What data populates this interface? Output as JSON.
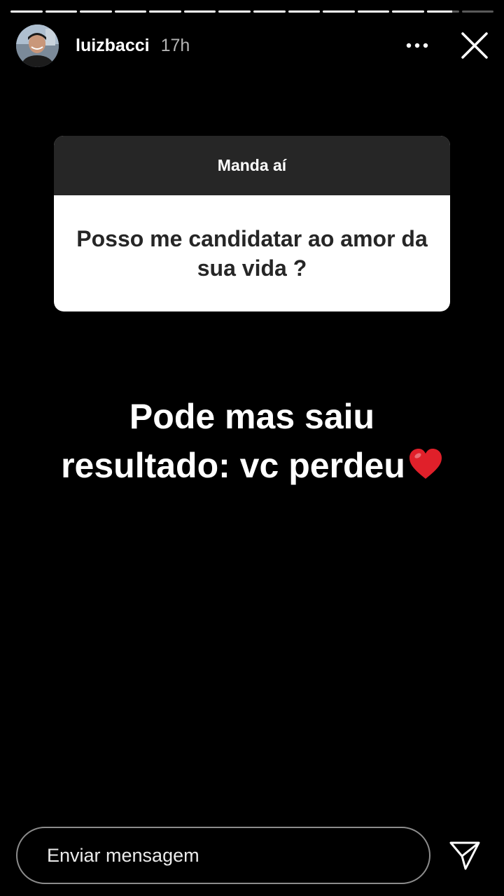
{
  "story": {
    "segment_count": 14,
    "viewed_segments": 12,
    "current_segment_progress": 0.8
  },
  "header": {
    "username": "luizbacci",
    "time": "17h",
    "more_icon": "more-horizontal-icon",
    "close_icon": "close-icon"
  },
  "question_sticker": {
    "title": "Manda aí",
    "question": "Posso me candidatar ao amor da sua vida ?"
  },
  "answer": {
    "line1": "Pode mas saiu",
    "line2": "resultado: vc perdeu",
    "emoji": "heart-icon",
    "emoji_color": "#e0202a"
  },
  "footer": {
    "message_placeholder": "Enviar mensagem",
    "send_icon": "paper-plane-icon"
  }
}
